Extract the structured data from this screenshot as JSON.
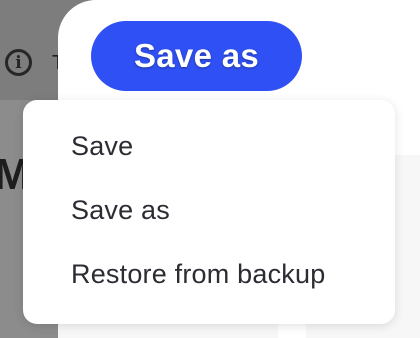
{
  "background": {
    "info_icon": "info-icon",
    "info_glyph": "i",
    "heading_fragment": "Ma",
    "toolbar_fragment": "T"
  },
  "save_as_button": {
    "label": "Save as",
    "color": "#2f50f4"
  },
  "menu": {
    "items": [
      {
        "label": "Save"
      },
      {
        "label": "Save as"
      },
      {
        "label": "Restore from backup"
      }
    ]
  }
}
